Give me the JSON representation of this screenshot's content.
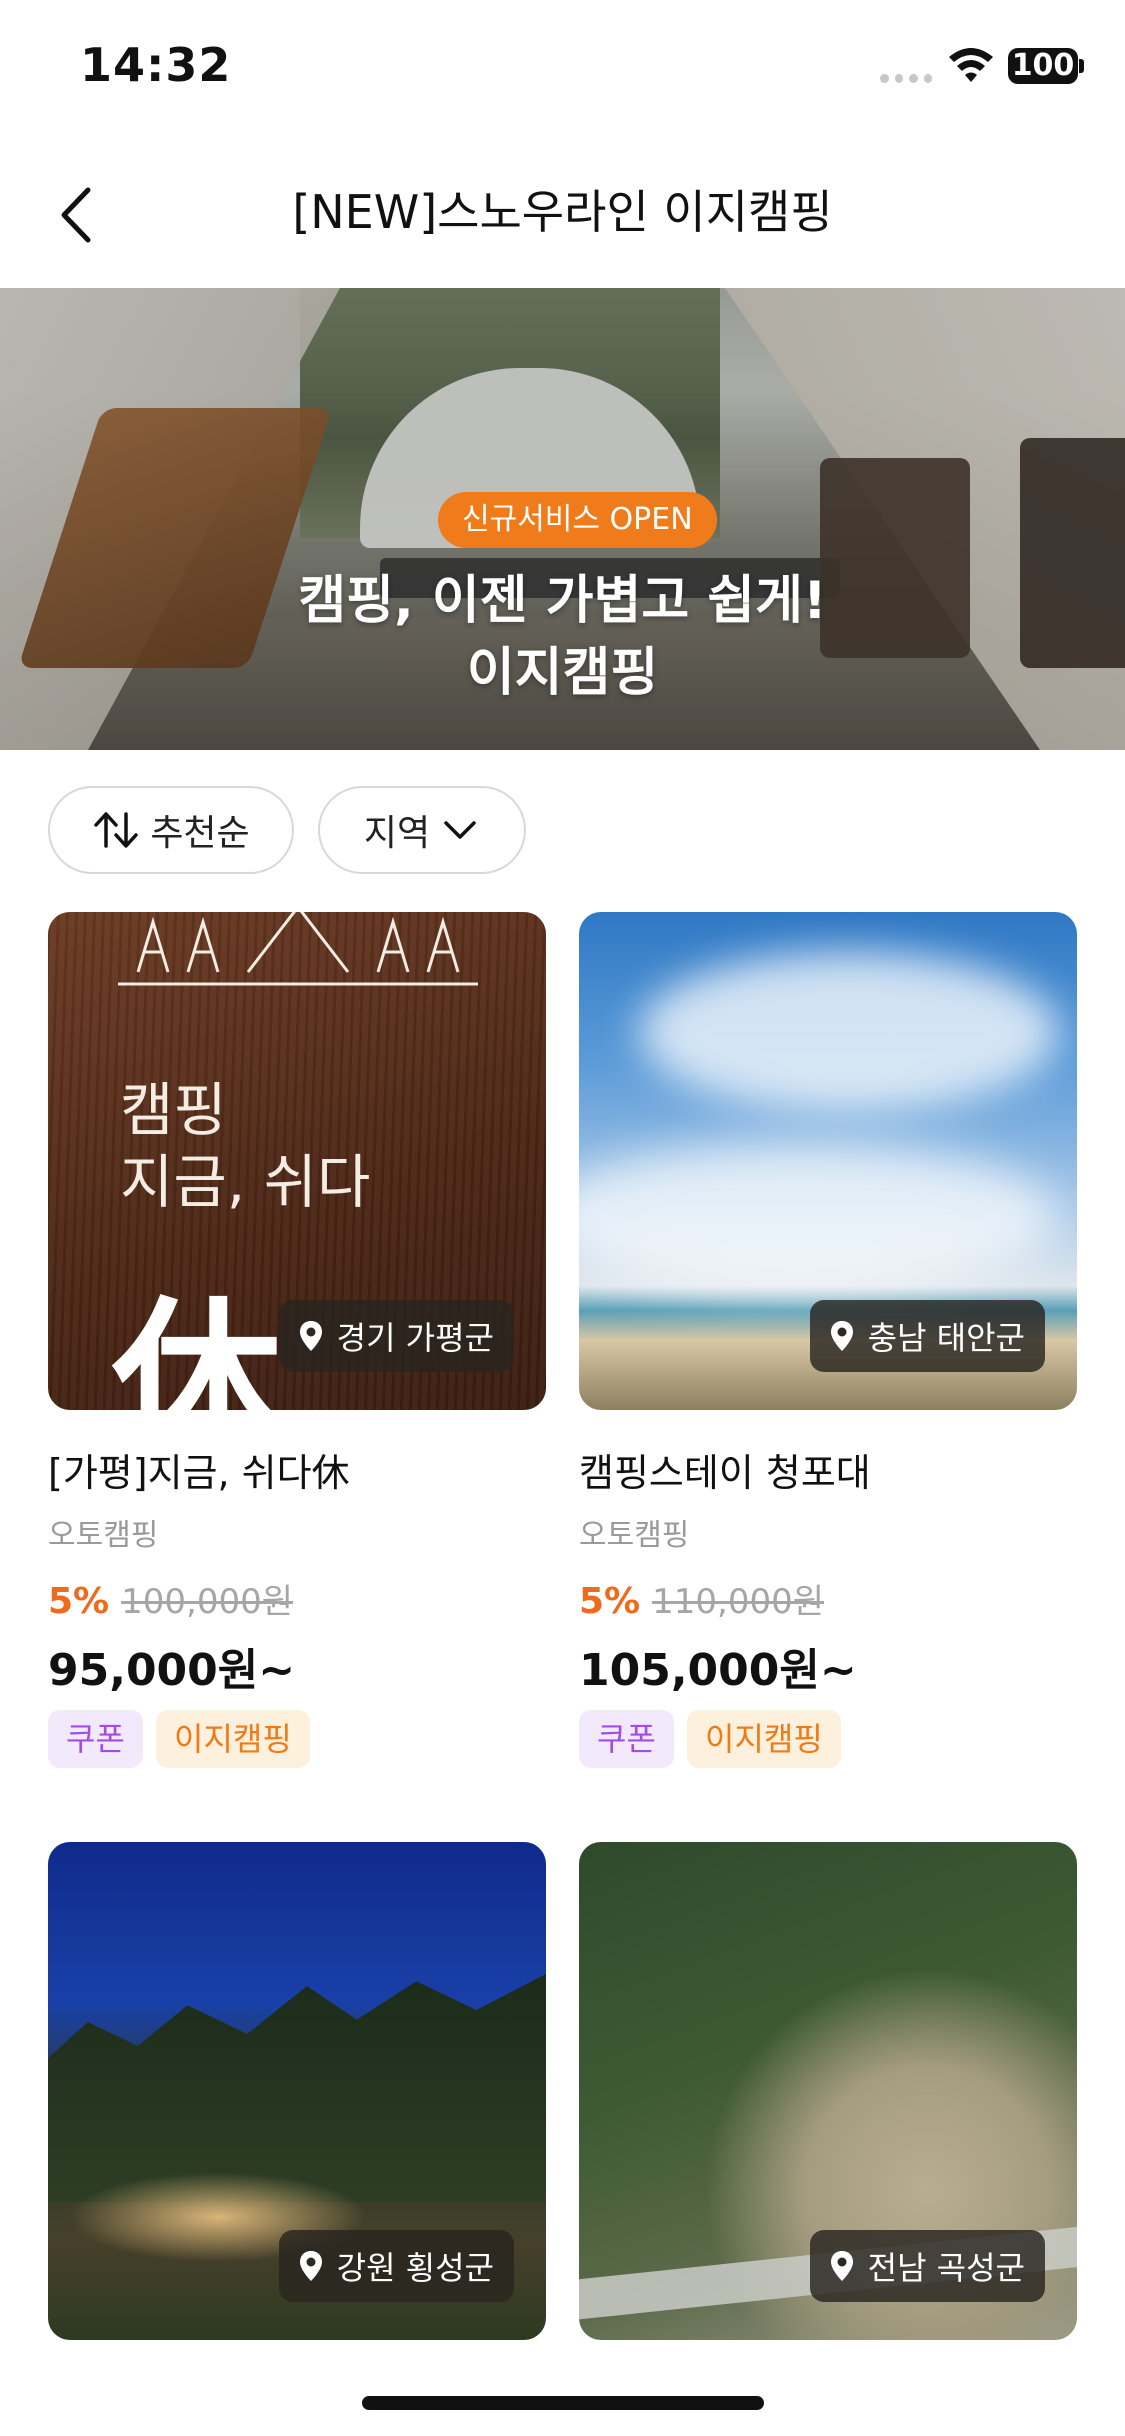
{
  "status_bar": {
    "time": "14:32",
    "battery": "100"
  },
  "header": {
    "title": "[NEW]스노우라인 이지캠핑"
  },
  "hero": {
    "badge": "신규서비스 OPEN",
    "line1": "캠핑, 이젠 가볍고 쉽게!",
    "line2": "이지캠핑"
  },
  "filters": {
    "sort_label": "추천순",
    "region_label": "지역"
  },
  "listings": [
    {
      "location": "경기 가평군",
      "title": "[가평]지금, 쉬다休",
      "category": "오토캠핑",
      "discount": "5%",
      "original_price": "100,000원",
      "price": "95,000원~",
      "tags": [
        "쿠폰",
        "이지캠핑"
      ],
      "image_text_line1": "캠핑",
      "image_text_line2": "지금, 쉬다",
      "image_text_big": "休"
    },
    {
      "location": "충남 태안군",
      "title": "캠핑스테이 청포대",
      "category": "오토캠핑",
      "discount": "5%",
      "original_price": "110,000원",
      "price": "105,000원~",
      "tags": [
        "쿠폰",
        "이지캠핑"
      ]
    },
    {
      "location": "강원 횡성군"
    },
    {
      "location": "전남 곡성군"
    }
  ],
  "colors": {
    "accent_orange": "#ef6a1a",
    "coupon_purple": "#a24ee6",
    "coupon_bg": "#f3e9fd",
    "easy_bg": "#fdf1dd"
  }
}
